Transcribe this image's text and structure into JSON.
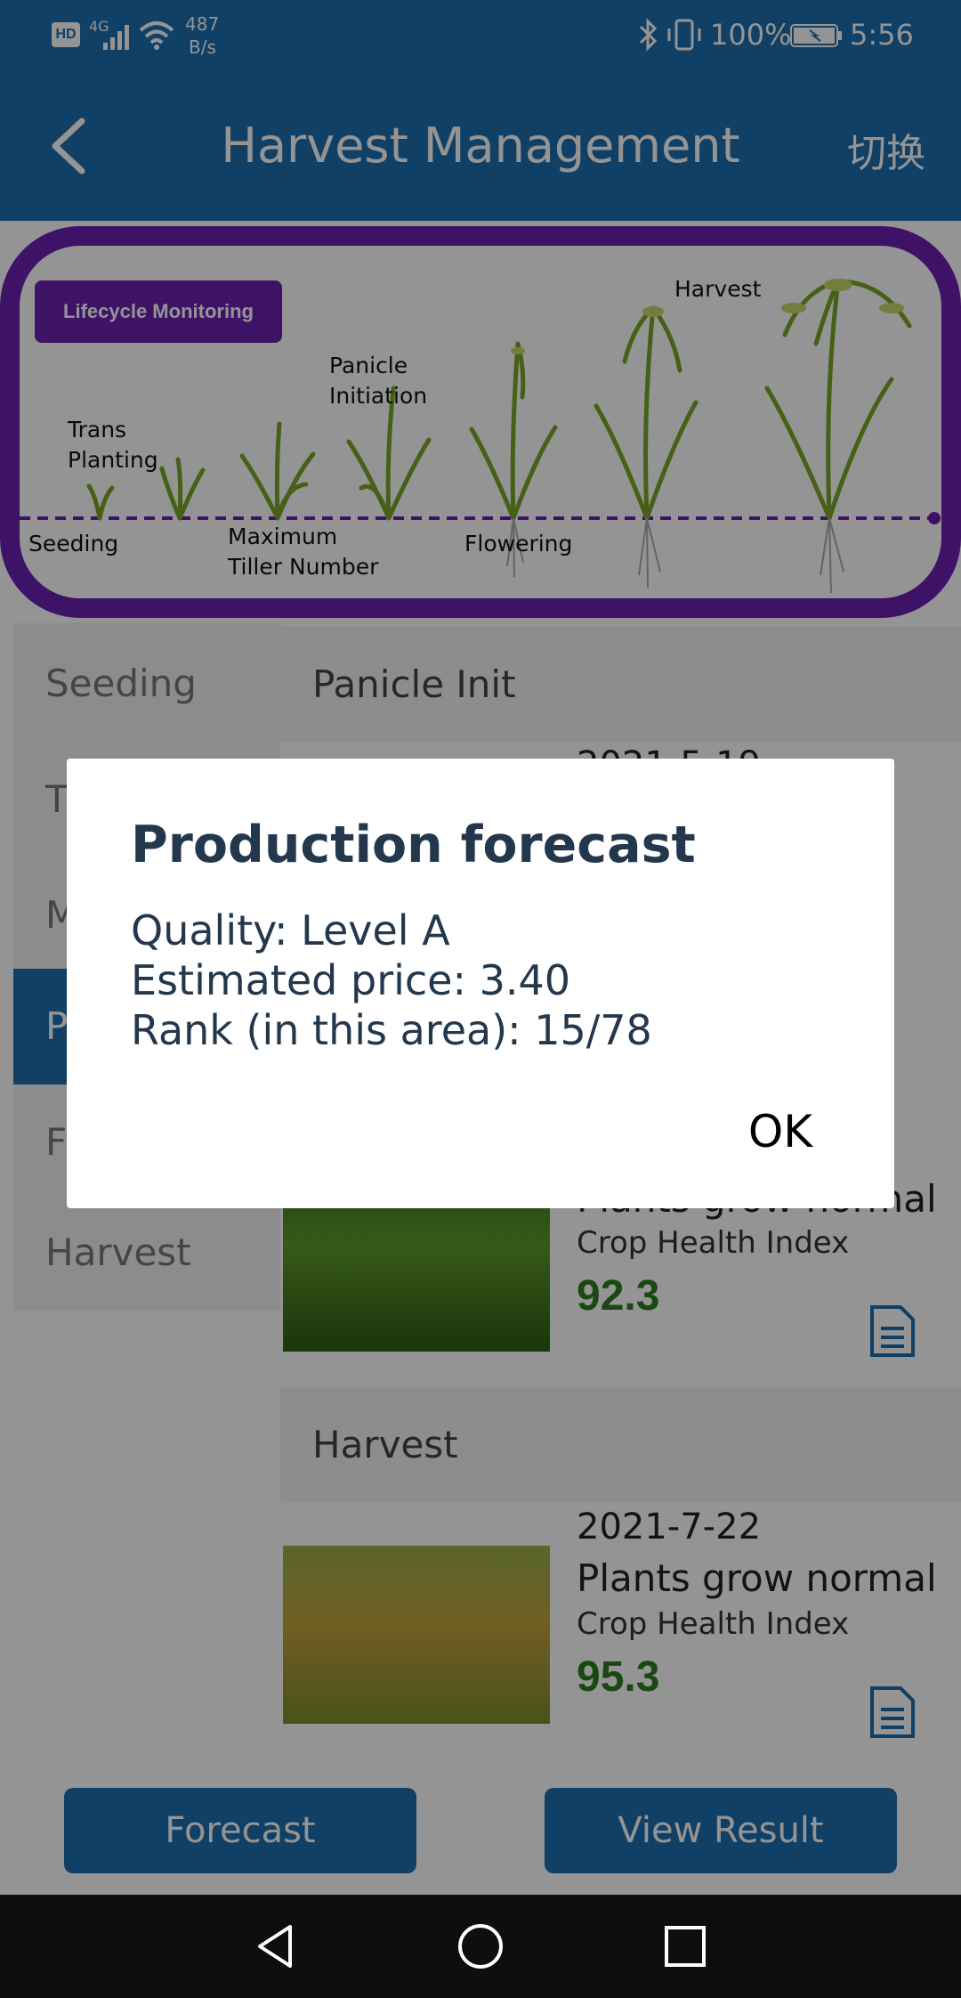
{
  "status_bar": {
    "hd": "HD",
    "network": "4G",
    "speed_value": "487",
    "speed_unit": "B/s",
    "battery": "100%",
    "time": "5:56"
  },
  "header": {
    "title": "Harvest Management",
    "switch_label": "切换"
  },
  "banner": {
    "badge": "Lifecycle Monitoring",
    "stages": {
      "seeding": "Seeding",
      "trans_planting_1": "Trans",
      "trans_planting_2": "Planting",
      "max_tiller_1": "Maximum",
      "max_tiller_2": "Tiller Number",
      "panicle_1": "Panicle",
      "panicle_2": "Initiation",
      "flowering": "Flowering",
      "harvest": "Harvest"
    }
  },
  "stage_list": [
    {
      "label": "Seeding"
    },
    {
      "label": "T"
    },
    {
      "label": "M"
    },
    {
      "label": "P"
    },
    {
      "label": "F"
    },
    {
      "label": "Harvest"
    }
  ],
  "sections": [
    {
      "title": "Panicle Init",
      "date": "2021-5-19"
    },
    {
      "title": "",
      "status": "Plants grow normal",
      "index_label": "Crop Health Index",
      "index_value": "92.3"
    },
    {
      "title": "Harvest",
      "date": "2021-7-22",
      "status": "Plants grow normal",
      "index_label": "Crop Health Index",
      "index_value": "95.3"
    }
  ],
  "buttons": {
    "forecast": "Forecast",
    "view_result": "View Result"
  },
  "dialog": {
    "title": "Production forecast",
    "quality": "Quality: Level A",
    "price": "Estimated price: 3.40",
    "rank": "Rank (in this area): 15/78",
    "ok": "OK"
  },
  "colors": {
    "primary": "#1c6fae",
    "banner_purple": "#6c1fb0",
    "health_green": "#2e7d1f"
  }
}
